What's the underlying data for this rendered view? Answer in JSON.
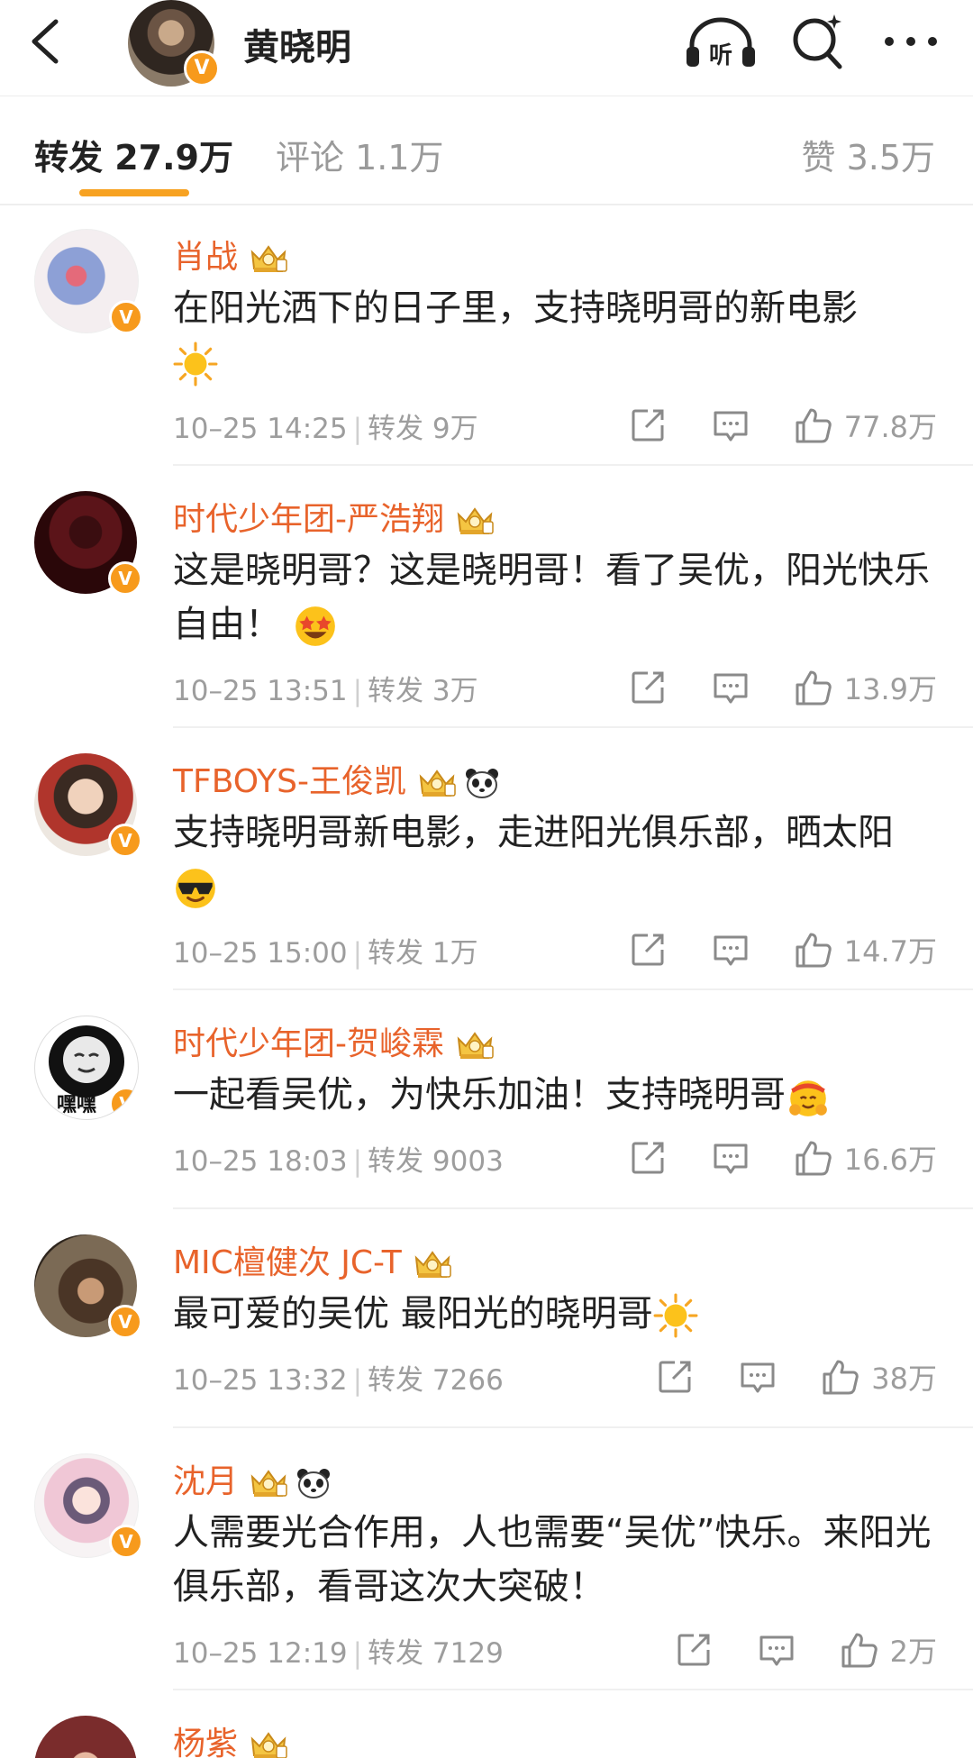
{
  "header": {
    "title": "黄晓明",
    "listen_label": "听"
  },
  "tabs": {
    "repost": "转发 27.9万",
    "comment": "评论 1.1万",
    "like": "赞 3.5万"
  },
  "verified_mark": "V",
  "comments": [
    {
      "name": "肖战",
      "text": "在阳光洒下的日子里，支持晓明哥的新电影",
      "emoji": "sun",
      "time": "10–25 14:25",
      "repost": "转发 9万",
      "likes": "77.8万"
    },
    {
      "name": "时代少年团-严浩翔",
      "text": "这是晓明哥？这是晓明哥！看了吴优，阳光快乐自由！",
      "emoji": "starstruck",
      "time": "10–25 13:51",
      "repost": "转发 3万",
      "likes": "13.9万"
    },
    {
      "name": "TFBOYS-王俊凯",
      "text": "支持晓明哥新电影，走进阳光俱乐部，晒太阳",
      "emoji": "cool",
      "time": "10–25 15:00",
      "repost": "转发 1万",
      "likes": "14.7万"
    },
    {
      "name": "时代少年团-贺峻霖",
      "text": "一起看吴优，为快乐加油！支持晓明哥",
      "emoji": "cheer",
      "avatar_caption": "嘿嘿",
      "time": "10–25 18:03",
      "repost": "转发 9003",
      "likes": "16.6万"
    },
    {
      "name": "MIC檀健次 JC-T",
      "text": "最可爱的吴优 最阳光的晓明哥",
      "emoji": "sun",
      "time": "10–25 13:32",
      "repost": "转发 7266",
      "likes": "38万"
    },
    {
      "name": "沈月",
      "text": "人需要光合作用，人也需要“吴优”快乐。来阳光俱乐部，看哥这次大突破！",
      "emoji": "",
      "time": "10–25 12:19",
      "repost": "转发 7129",
      "likes": "2万"
    },
    {
      "name": "杨紫"
    }
  ],
  "icons": {
    "back": "back-arrow-icon",
    "listen": "headphones-icon",
    "search": "search-sparkle-icon",
    "more": "more-dots-icon",
    "share": "share-icon",
    "comment": "comment-icon",
    "like": "thumbs-up-icon"
  },
  "colors": {
    "accent": "#f7a222",
    "username": "#e8632b",
    "verified": "#f79a1c",
    "meta": "#9d9d9d"
  }
}
